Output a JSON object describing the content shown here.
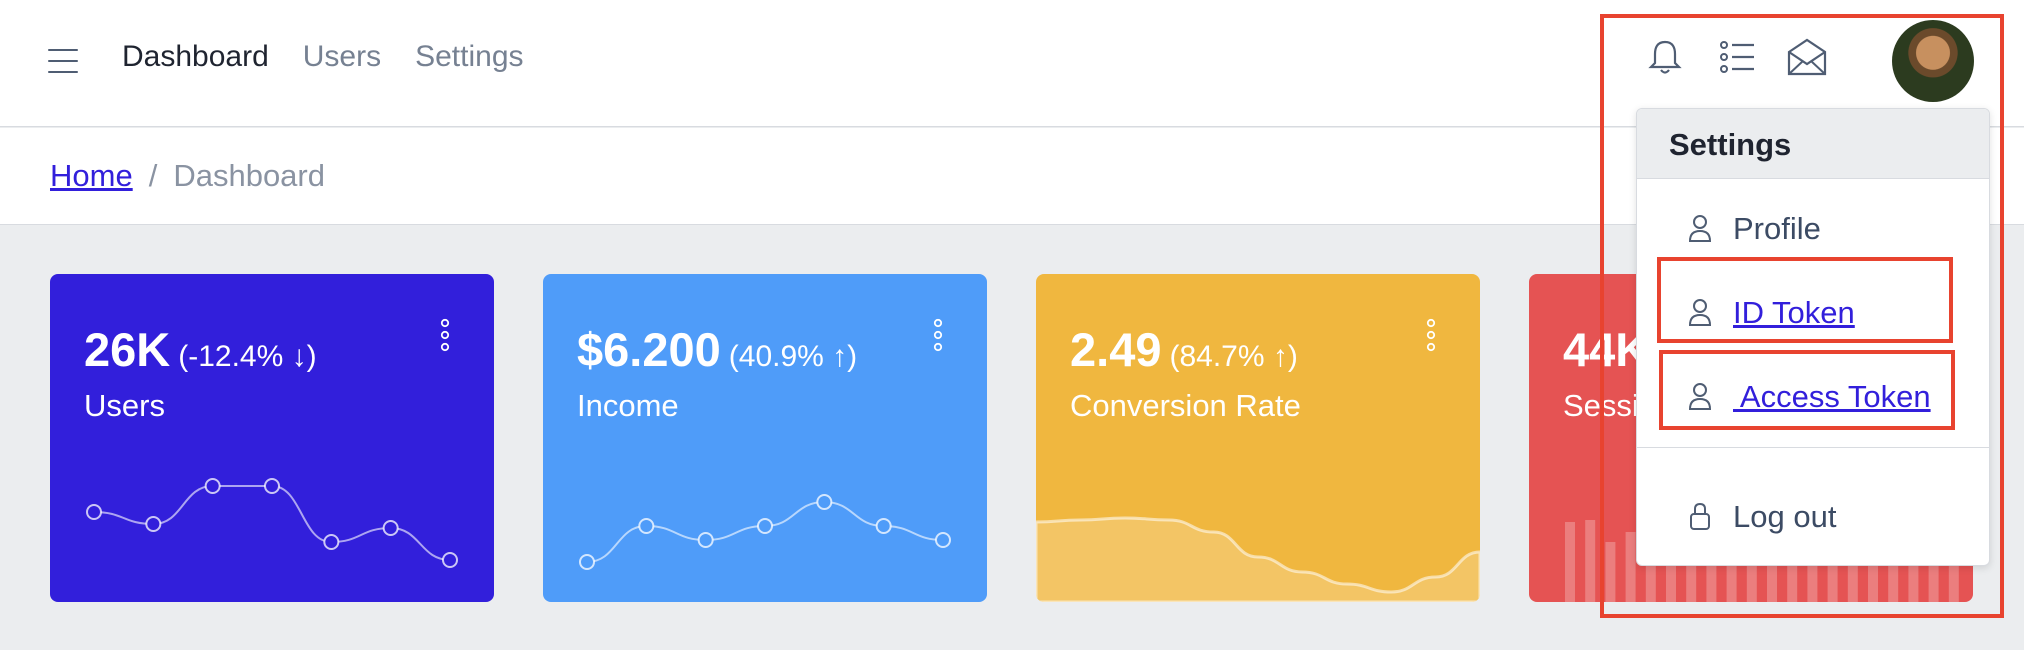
{
  "header": {
    "nav": [
      "Dashboard",
      "Users",
      "Settings"
    ],
    "icons": [
      "bell-icon",
      "list-icon",
      "envelope-icon"
    ]
  },
  "breadcrumb": {
    "home": "Home",
    "separator": "/",
    "current": "Dashboard"
  },
  "cards": [
    {
      "value": "26K",
      "change": "(-12.4% ↓)",
      "label": "Users",
      "color": "#321fdb",
      "chart": "line",
      "points": [
        70,
        58,
        96,
        96,
        40,
        54,
        22
      ]
    },
    {
      "value": "$6.200",
      "change": "(40.9% ↑)",
      "label": "Income",
      "color": "#4f9cf9",
      "chart": "line",
      "points": [
        20,
        56,
        42,
        56,
        80,
        56,
        42
      ]
    },
    {
      "value": "2.49",
      "change": "(84.7% ↑)",
      "label": "Conversion Rate",
      "color": "#f0b73f",
      "chart": "area",
      "points": [
        80,
        82,
        84,
        82,
        70,
        45,
        30,
        18,
        10,
        25,
        50
      ]
    },
    {
      "value": "44K",
      "change": "",
      "label": "Sessions",
      "color": "#e55353",
      "chart": "bar",
      "points": [
        80,
        82,
        60,
        70,
        55,
        78,
        65,
        40,
        58,
        72,
        50,
        68,
        62,
        75,
        45,
        70,
        60,
        52,
        66,
        58
      ]
    }
  ],
  "dropdown": {
    "header": "Settings",
    "items": [
      "Profile",
      "ID Token",
      " Access Token"
    ],
    "logout": "Log out"
  },
  "colors": {
    "highlight": "#e8432f",
    "link": "#321fdb"
  }
}
